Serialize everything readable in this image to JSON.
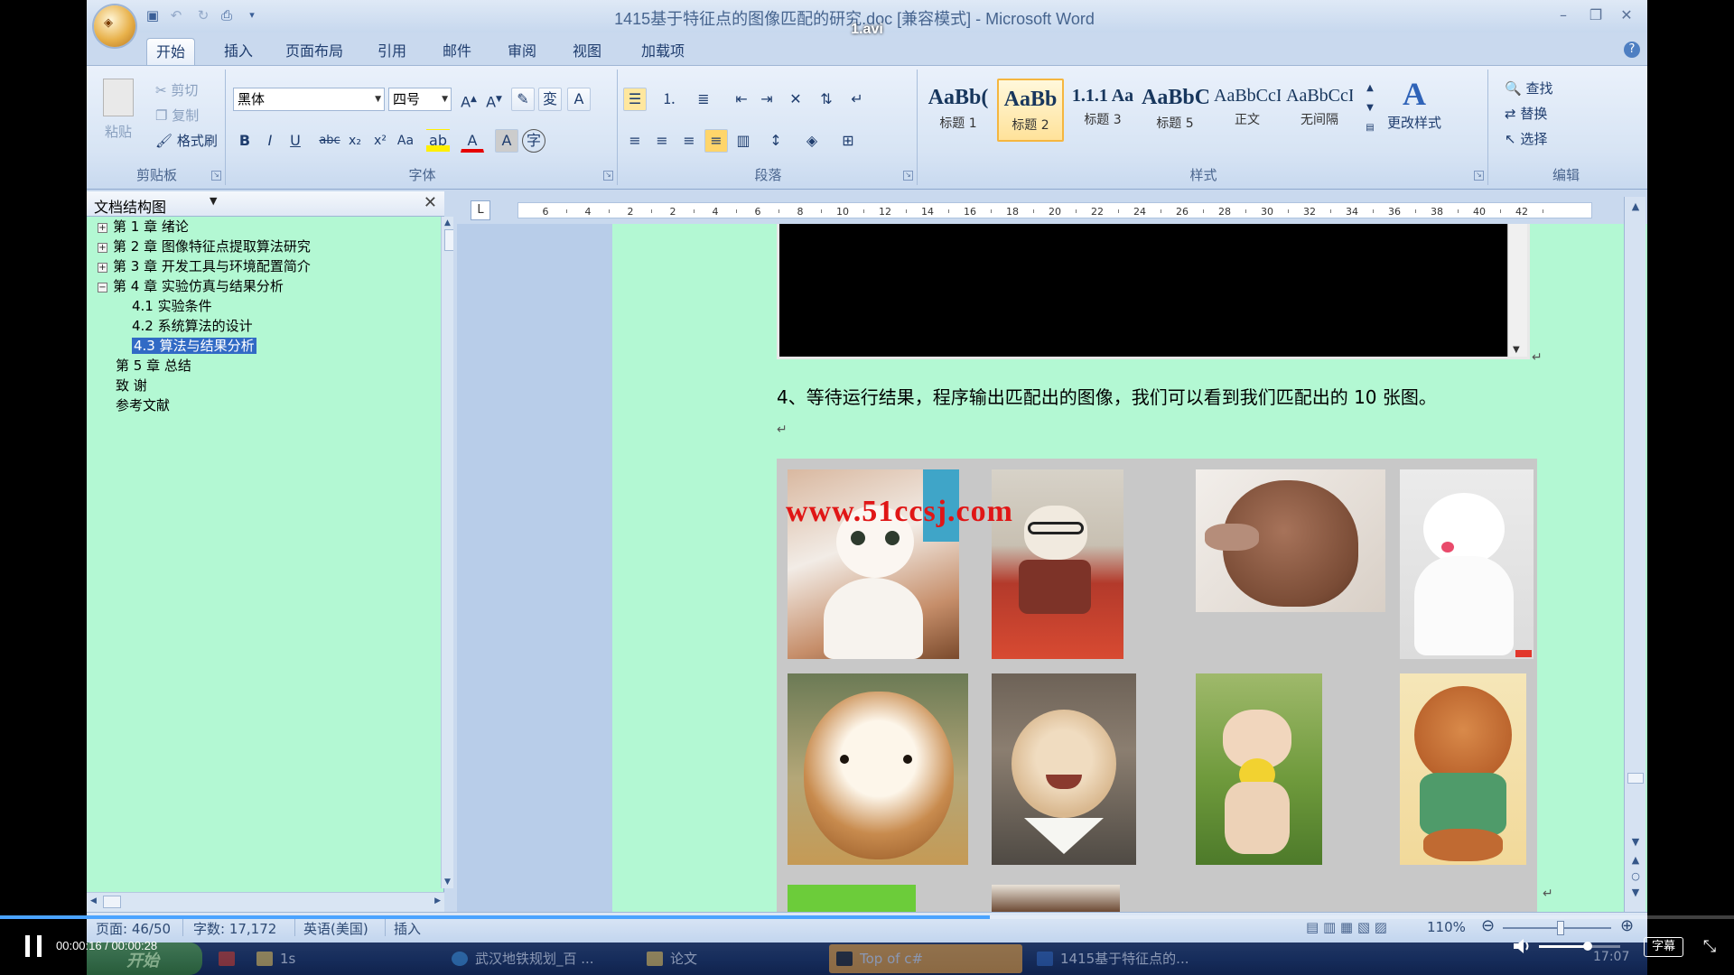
{
  "video": {
    "filename": "1.avi",
    "time_display": "00:00:16 / 00:00:28",
    "progress": 0.571,
    "volume": 0.6,
    "subtitle_label": "字幕"
  },
  "window": {
    "title": "1415基于特征点的图像匹配的研究.doc [兼容模式] - Microsoft Word",
    "tabs": [
      "开始",
      "插入",
      "页面布局",
      "引用",
      "邮件",
      "审阅",
      "视图",
      "加载项"
    ],
    "active_tab": "开始"
  },
  "ribbon": {
    "clipboard": {
      "paste": "粘贴",
      "cut": "剪切",
      "copy": "复制",
      "format_painter": "格式刷",
      "label": "剪贴板"
    },
    "font": {
      "font_name": "黑体",
      "font_size": "四号",
      "label": "字体"
    },
    "paragraph": {
      "label": "段落"
    },
    "styles": {
      "label": "样式",
      "change_styles": "更改样式",
      "items": [
        {
          "sample": "AaBb(",
          "name": "标题 1"
        },
        {
          "sample": "AaBb",
          "name": "标题 2"
        },
        {
          "sample": "1.1.1  Aa",
          "name": "标题 3"
        },
        {
          "sample": "AaBbC",
          "name": "标题 5"
        },
        {
          "sample": "AaBbCcI",
          "name": "正文"
        },
        {
          "sample": "AaBbCcI",
          "name": "无间隔"
        }
      ],
      "selected": "标题 2"
    },
    "editing": {
      "find": "查找",
      "replace": "替换",
      "select": "选择",
      "label": "编辑"
    }
  },
  "docmap": {
    "title": "文档结构图",
    "items": [
      {
        "toggle": "+",
        "text": "第 1 章  绪论"
      },
      {
        "toggle": "+",
        "text": "第 2 章  图像特征点提取算法研究"
      },
      {
        "toggle": "+",
        "text": "第 3 章    开发工具与环境配置简介"
      },
      {
        "toggle": "−",
        "text": "第 4 章  实验仿真与结果分析"
      },
      {
        "toggle": "",
        "text": "4.1 实验条件"
      },
      {
        "toggle": "",
        "text": "4.2 系统算法的设计"
      },
      {
        "toggle": "",
        "text": "4.3  算法与结果分析"
      },
      {
        "toggle": "",
        "text": "第 5 章  总结"
      },
      {
        "toggle": "",
        "text": "致  谢"
      },
      {
        "toggle": "",
        "text": "参考文献"
      }
    ],
    "selected_index": 6
  },
  "ruler": {
    "ticks": [
      "6",
      "4",
      "2",
      "2",
      "4",
      "6",
      "8",
      "10",
      "12",
      "14",
      "16",
      "18",
      "20",
      "22",
      "24",
      "26",
      "28",
      "30",
      "32",
      "34",
      "36",
      "38",
      "40",
      "42"
    ]
  },
  "document": {
    "paragraph": "4、等待运行结果，程序输出匹配出的图像，我们可以看到我们匹配出的 10 张图。",
    "watermark": "www.51ccsj.com"
  },
  "status": {
    "page": "页面: 46/50",
    "words": "字数: 17,172",
    "language": "英语(美国)",
    "mode": "插入",
    "zoom": "110%"
  },
  "taskbar": {
    "start": "开始",
    "items": [
      "1s",
      "武汉地铁规划_百 ...",
      "论文",
      "Top of c#",
      "1415基于特征点的..."
    ],
    "clock": "17:07"
  },
  "colors": {
    "page_bg": "#b3f8d3",
    "ribbon_bg": "#d7e4f4",
    "selection": "#316ac5",
    "watermark": "#e01616"
  }
}
